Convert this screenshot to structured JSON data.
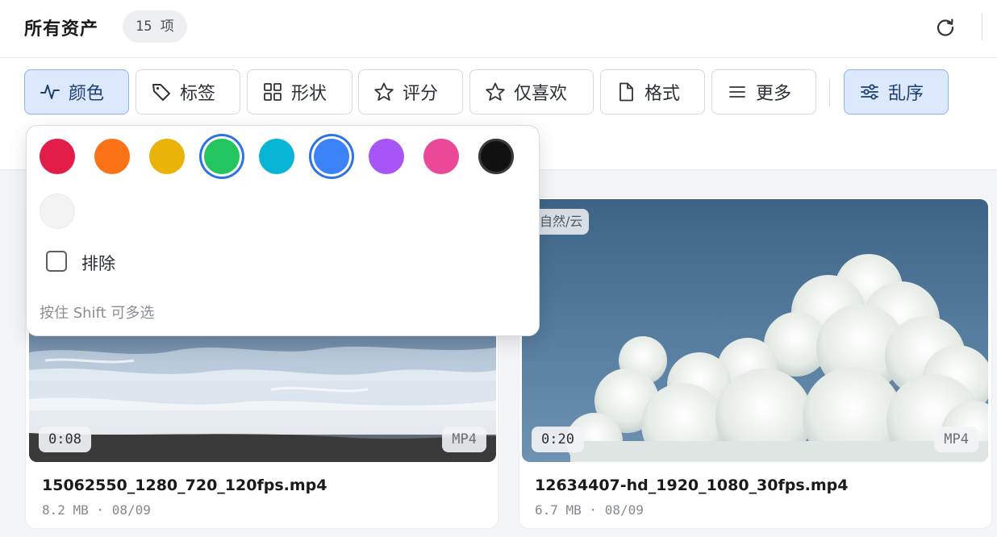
{
  "header": {
    "title": "所有资产",
    "count": "15 项",
    "refresh_icon": "refresh-icon"
  },
  "filters": {
    "color": {
      "label": "颜色",
      "icon": "activity-icon",
      "active": true
    },
    "tags": {
      "label": "标签",
      "icon": "tag-icon"
    },
    "shape": {
      "label": "形状",
      "icon": "grid-icon"
    },
    "rating": {
      "label": "评分",
      "icon": "star-icon"
    },
    "favorites": {
      "label": "仅喜欢",
      "icon": "star-outline-icon"
    },
    "format": {
      "label": "格式",
      "icon": "file-icon"
    },
    "more": {
      "label": "更多",
      "icon": "menu-icon"
    },
    "shuffle": {
      "label": "乱序",
      "icon": "sliders-icon",
      "active": true
    }
  },
  "color_popover": {
    "swatches": [
      {
        "color": "#e11d48",
        "selected": false
      },
      {
        "color": "#f97316",
        "selected": false
      },
      {
        "color": "#eab308",
        "selected": false
      },
      {
        "color": "#22c55e",
        "selected": true
      },
      {
        "color": "#06b6d4",
        "selected": false
      },
      {
        "color": "#3b82f6",
        "selected": true
      },
      {
        "color": "#a855f7",
        "selected": false
      },
      {
        "color": "#ec4899",
        "selected": false
      },
      {
        "color": "#111111",
        "selected": false
      },
      {
        "color": "#f3f3f3",
        "selected": false
      }
    ],
    "exclude_label": "排除",
    "exclude_checked": false,
    "hint": "按住 Shift 可多选"
  },
  "assets": [
    {
      "filename": "15062550_1280_720_120fps.mp4",
      "size": "8.2 MB",
      "date": "08/09",
      "meta": "8.2 MB · 08/09",
      "duration": "0:08",
      "format": "MP4"
    },
    {
      "filename": "12634407-hd_1920_1080_30fps.mp4",
      "size": "6.7 MB",
      "date": "08/09",
      "meta": "6.7 MB · 08/09",
      "duration": "0:20",
      "format": "MP4",
      "tag": "自然/云"
    }
  ]
}
